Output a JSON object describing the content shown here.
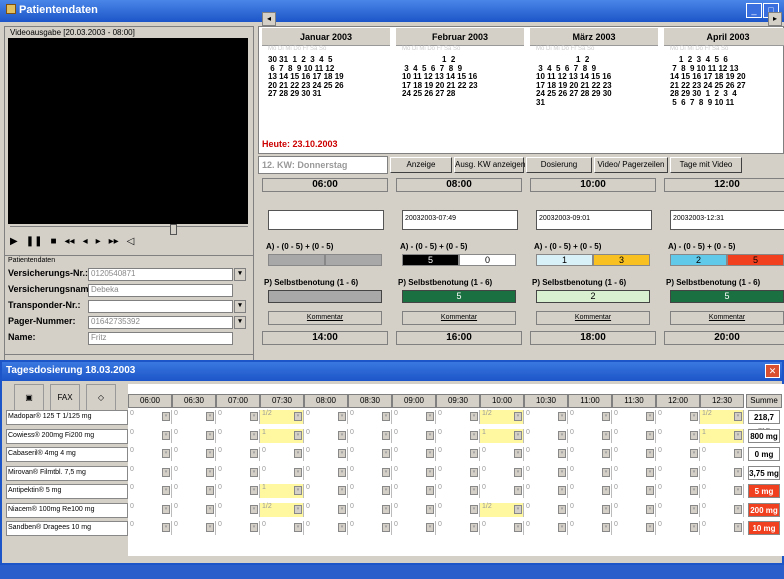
{
  "window": {
    "title": "Patientendaten"
  },
  "video": {
    "label": "Videoausgabe [20.03.2003 - 08:00]"
  },
  "patient": {
    "title": "Patientendaten",
    "fields": [
      {
        "label": "Versicherungs-Nr.:",
        "value": "0120540871"
      },
      {
        "label": "Versicherungsname:",
        "value": "Debeka"
      },
      {
        "label": "Transponder-Nr.:",
        "value": ""
      },
      {
        "label": "Pager-Nummer:",
        "value": "01642735392"
      },
      {
        "label": "Name:",
        "value": "Fritz"
      }
    ]
  },
  "calendar": {
    "months": [
      {
        "name": "Januar 2003",
        "days": "30 31  1  2  3  4  5\n 6  7  8  9 10 11 12\n13 14 15 16 17 18 19\n20 21 22 23 24 25 26\n27 28 29 30 31"
      },
      {
        "name": "Februar 2003",
        "days": "                  1  2\n 3  4  5  6  7  8  9\n10 11 12 13 14 15 16\n17 18 19 20 21 22 23\n24 25 26 27 28"
      },
      {
        "name": "März 2003",
        "days": "                  1  2\n 3  4  5  6  7  8  9\n10 11 12 13 14 15 16\n17 18 19 20 21 22 23\n24 25 26 27 28 29 30\n31"
      },
      {
        "name": "April 2003",
        "days": "    1  2  3  4  5  6\n 7  8  9 10 11 12 13\n14 15 16 17 18 19 20\n21 22 23 24 25 26 27\n28 29 30  1  2  3  4\n 5  6  7  8  9 10 11"
      }
    ],
    "today": "Heute: 23.10.2003"
  },
  "toolbar": {
    "kw": "12. KW: Donnerstag",
    "buttons": [
      "Anzeige",
      "Ausg. KW anzeigen",
      "Dosierung",
      "Video/ Pagerzeilen",
      "Tage mit Video"
    ]
  },
  "times": [
    {
      "time": "06:00",
      "stamp": "",
      "a": "",
      "b": "",
      "ps": "",
      "next": "14:00"
    },
    {
      "time": "08:00",
      "stamp": "20032003-07:49",
      "a": "5",
      "b": "0",
      "ps": "5",
      "next": "16:00"
    },
    {
      "time": "10:00",
      "stamp": "20032003-09:01",
      "a": "1",
      "b": "3",
      "ps": "2",
      "next": "18:00"
    },
    {
      "time": "12:00",
      "stamp": "20032003-12:31",
      "a": "2",
      "b": "5",
      "ps": "5",
      "next": "20:00"
    }
  ],
  "labels": {
    "a": "A) - (0 - 5)",
    "b": "+ (0 - 5)",
    "ps": "P) Selbstbenotung (1 - 6)",
    "kom": "Kommentar"
  },
  "colors": {
    "a_black": "#000000",
    "b_white": "#ffffff",
    "a_light": "#d8f0f8",
    "b_orange": "#f8c020",
    "a_cyan": "#60c8e8",
    "b_red": "#f04020",
    "ps_green": "#1a7040",
    "ps_light": "#d8f0d0"
  },
  "dosing": {
    "title": "Tagesdosierung 18.03.2003",
    "tools": [
      "save-icon",
      "fax-icon",
      "eraser-icon"
    ],
    "times": [
      "06:00",
      "06:30",
      "07:00",
      "07:30",
      "08:00",
      "08:30",
      "09:00",
      "09:30",
      "10:00",
      "10:30",
      "11:00",
      "11:30",
      "12:00",
      "12:30"
    ],
    "sum_label": "Summe",
    "rows": [
      {
        "name": "Madopar® 125 T 1/125 mg",
        "sum": "218,7 mg",
        "vals": [
          "0",
          "0",
          "0",
          "1/2",
          "0",
          "0",
          "0",
          "0",
          "1/2",
          "0",
          "0",
          "0",
          "0",
          "1/2"
        ]
      },
      {
        "name": "Cowiess® 200mg Fi200 mg",
        "sum": "800 mg",
        "vals": [
          "0",
          "0",
          "0",
          "1",
          "0",
          "0",
          "0",
          "0",
          "1",
          "0",
          "0",
          "0",
          "0",
          "1"
        ]
      },
      {
        "name": "Cabaseril® 4mg    4 mg",
        "sum": "0 mg",
        "vals": [
          "0",
          "0",
          "0",
          "0",
          "0",
          "0",
          "0",
          "0",
          "0",
          "0",
          "0",
          "0",
          "0",
          "0"
        ]
      },
      {
        "name": "Mirovan® Filmtbl. 7,5 mg",
        "sum": "3,75 mg",
        "vals": [
          "0",
          "0",
          "0",
          "0",
          "0",
          "0",
          "0",
          "0",
          "0",
          "0",
          "0",
          "0",
          "0",
          "0"
        ]
      },
      {
        "name": "Antipektin®       5 mg",
        "sum": "5 mg",
        "vals": [
          "0",
          "0",
          "0",
          "1",
          "0",
          "0",
          "0",
          "0",
          "0",
          "0",
          "0",
          "0",
          "0",
          "0"
        ]
      },
      {
        "name": "Niacem® 100mg Re100 mg",
        "sum": "200 mg",
        "vals": [
          "0",
          "0",
          "0",
          "1/2",
          "0",
          "0",
          "0",
          "0",
          "1/2",
          "0",
          "0",
          "0",
          "0",
          "0"
        ]
      },
      {
        "name": "Sandben® Dragees 10 mg",
        "sum": "10 mg",
        "vals": [
          "0",
          "0",
          "0",
          "0",
          "0",
          "0",
          "0",
          "0",
          "0",
          "0",
          "0",
          "0",
          "0",
          "0"
        ]
      }
    ]
  }
}
